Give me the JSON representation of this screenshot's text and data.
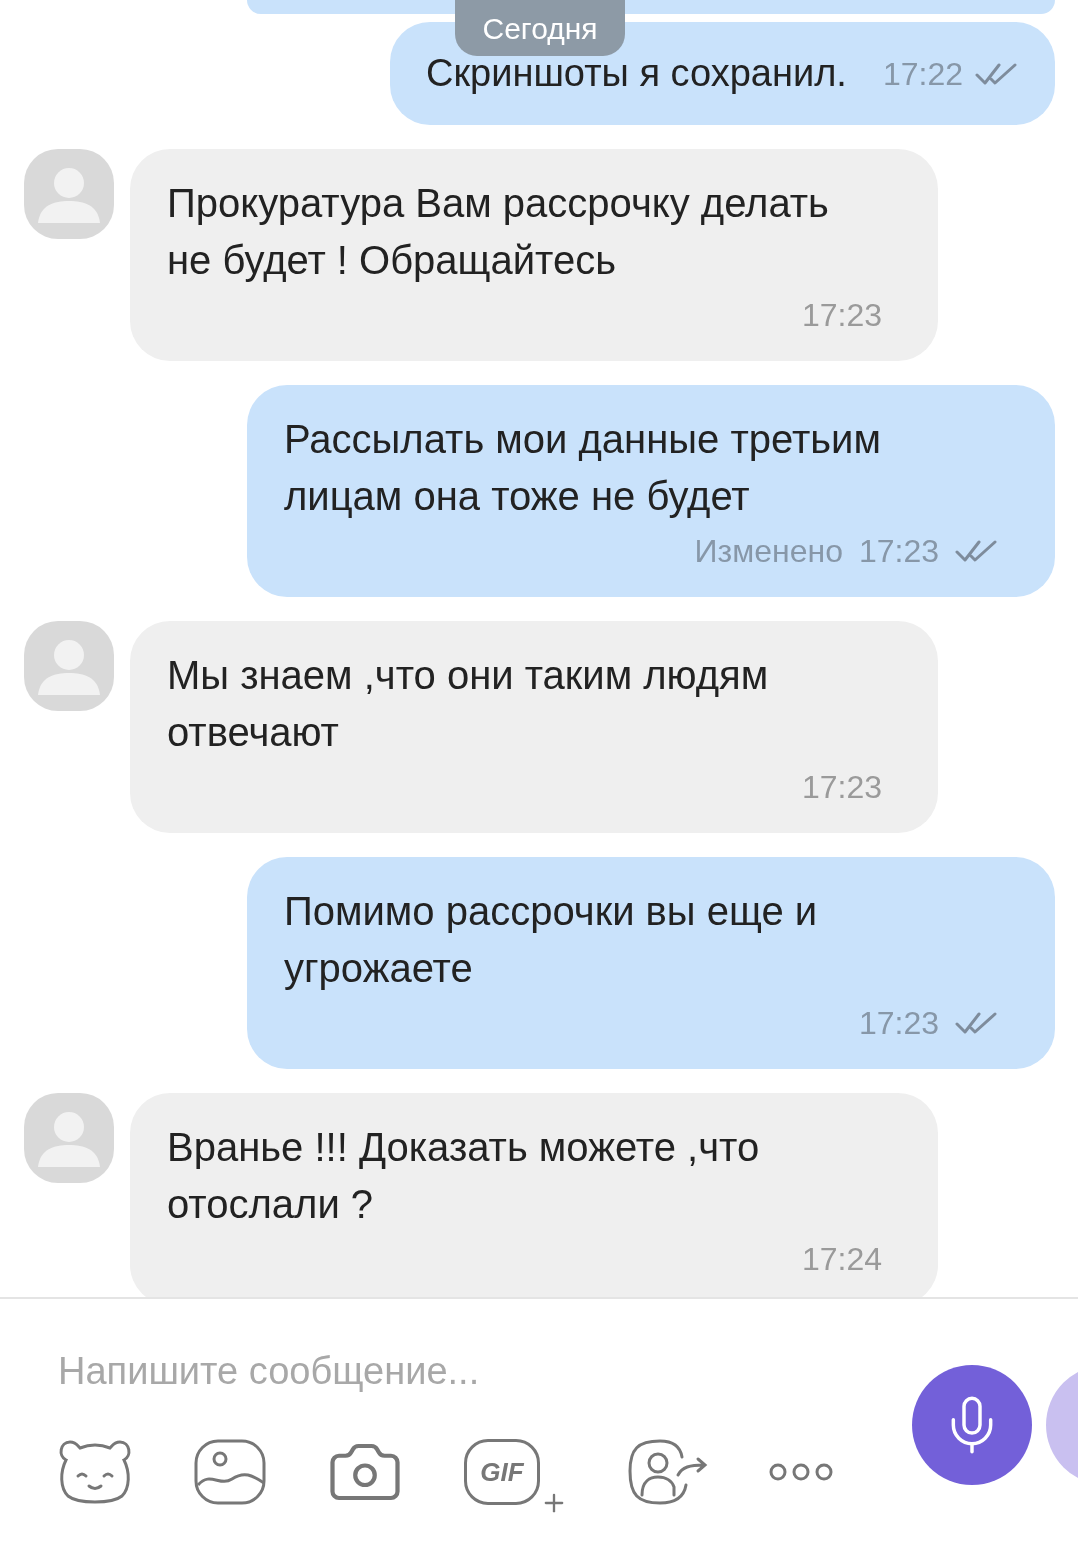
{
  "date_divider": "Сегодня",
  "messages": [
    {
      "kind": "outgoing",
      "text": "Скриншоты я сохранил.",
      "time": "17:22",
      "delivered": true
    },
    {
      "kind": "incoming",
      "text": "Прокуратура Вам рассрочку делать не будет ! Обращайтесь",
      "time": "17:23"
    },
    {
      "kind": "outgoing",
      "text": "Рассылать мои данные третьим лицам она тоже не будет",
      "edited_label": "Изменено",
      "time": "17:23",
      "delivered": true
    },
    {
      "kind": "incoming",
      "text": "Мы знаем ,что они таким людям отвечают",
      "time": "17:23"
    },
    {
      "kind": "outgoing",
      "text": "Помимо рассрочки вы еще и угрожаете",
      "time": "17:23",
      "delivered": true
    },
    {
      "kind": "incoming",
      "text": "Вранье !!! Доказать можете ,что отослали ?",
      "time": "17:24"
    }
  ],
  "composer": {
    "placeholder": "Напишите сообщение...",
    "gif_label": "GIF"
  }
}
